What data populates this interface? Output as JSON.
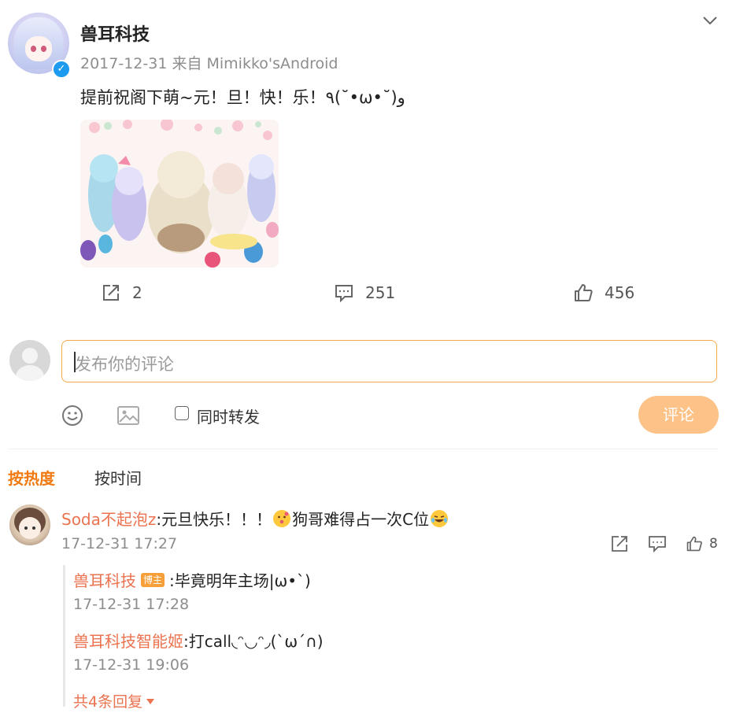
{
  "post": {
    "author": "兽耳科技",
    "meta": "2017-12-31 来自 Mimikko'sAndroid",
    "text": "提前祝阁下萌~元！旦！快！乐！٩(˘•ω•˘)و",
    "repost_count": "2",
    "comment_count": "251",
    "like_count": "456",
    "avatar_icon": "anime-avatar",
    "verified_icon": "verified-check-icon"
  },
  "composer": {
    "placeholder": "发布你的评论",
    "also_repost_label": "同时转发",
    "submit_label": "评论"
  },
  "sort": {
    "hot_label": "按热度",
    "time_label": "按时间"
  },
  "comment": {
    "author": "Soda不起泡z",
    "text_before_emoji": ":元旦快乐！！！",
    "text_after_emoji": "狗哥难得占一次C位",
    "time": "17-12-31 17:27",
    "like_count": "8",
    "replies": [
      {
        "author": "兽耳科技",
        "badge": "博主",
        "text": ":毕竟明年主场|ω•`)",
        "time": "17-12-31 17:28"
      },
      {
        "author": "兽耳科技智能姬",
        "text": ":打call◟ᵔ◡ᵔ◞(ˋωˊ∩)",
        "time": "17-12-31 19:06"
      }
    ],
    "more_replies_label": "共4条回复"
  },
  "colors": {
    "accent": "#f07a11",
    "name": "#eb7350",
    "input_border": "#f5a74b",
    "submit_bg": "#fcc287"
  }
}
